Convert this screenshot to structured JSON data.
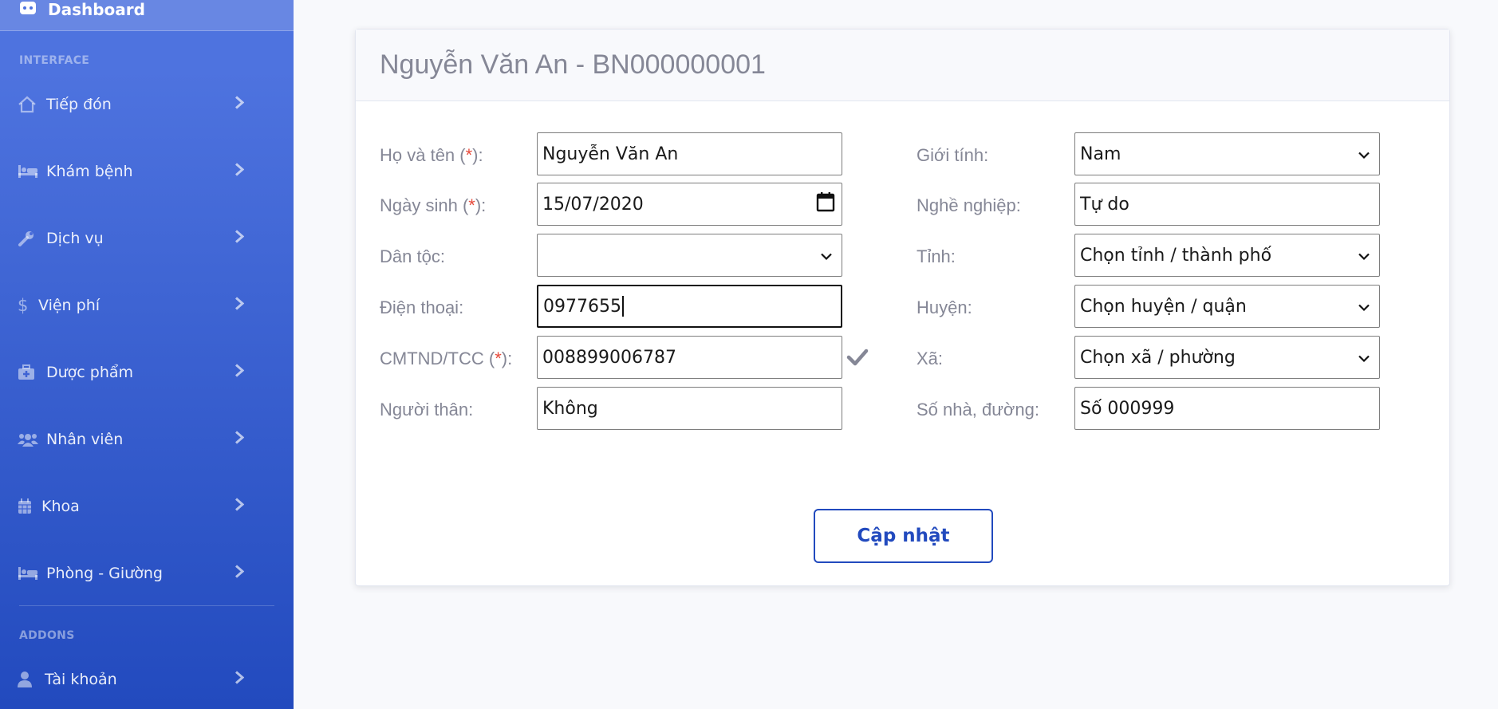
{
  "sidebar": {
    "top_item": "Dashboard",
    "heading_interface": "INTERFACE",
    "heading_addons": "ADDONS",
    "items": [
      {
        "label": "Tiếp đón",
        "icon": "home-icon"
      },
      {
        "label": "Khám bệnh",
        "icon": "bed-icon"
      },
      {
        "label": "Dịch vụ",
        "icon": "wrench-icon"
      },
      {
        "label": "Viện phí",
        "icon": "dollar-icon"
      },
      {
        "label": "Dược phẩm",
        "icon": "medkit-icon"
      },
      {
        "label": "Nhân viên",
        "icon": "users-icon"
      },
      {
        "label": "Khoa",
        "icon": "calendar-icon"
      },
      {
        "label": "Phòng - Giường",
        "icon": "bed-icon"
      }
    ],
    "addon_items": [
      {
        "label": "Tài khoản",
        "icon": "user-icon"
      }
    ]
  },
  "card": {
    "title": "Nguyễn Văn An - BN000000001"
  },
  "form": {
    "full_name": {
      "label": "Họ và tên (",
      "required": "*",
      "suffix": "):",
      "value": "Nguyễn Văn An"
    },
    "birth_date": {
      "label": "Ngày sinh (",
      "required": "*",
      "suffix": "):",
      "value": "15/07/2020"
    },
    "ethnicity": {
      "label": "Dân tộc:",
      "value": ""
    },
    "phone": {
      "label": "Điện thoại:",
      "value": "0977655"
    },
    "id_number": {
      "label": "CMTND/TCC (",
      "required": "*",
      "suffix": "):",
      "value": "008899006787"
    },
    "relative": {
      "label": "Người thân:",
      "value": "Không"
    },
    "gender": {
      "label": "Giới tính:",
      "value": "Nam"
    },
    "occupation": {
      "label": "Nghề nghiệp:",
      "value": "Tự do"
    },
    "province": {
      "label": "Tỉnh:",
      "value": "Chọn tỉnh / thành phố"
    },
    "district": {
      "label": "Huyện:",
      "value": "Chọn huyện / quận"
    },
    "ward": {
      "label": "Xã:",
      "value": "Chọn xã / phường"
    },
    "address": {
      "label": "Số nhà, đường:",
      "value": "Số 000999"
    }
  },
  "buttons": {
    "update": "Cập nhật"
  },
  "colors": {
    "sidebar_start": "#4e73df",
    "sidebar_end": "#224abe",
    "required": "#e74a3b",
    "label": "#858796"
  }
}
